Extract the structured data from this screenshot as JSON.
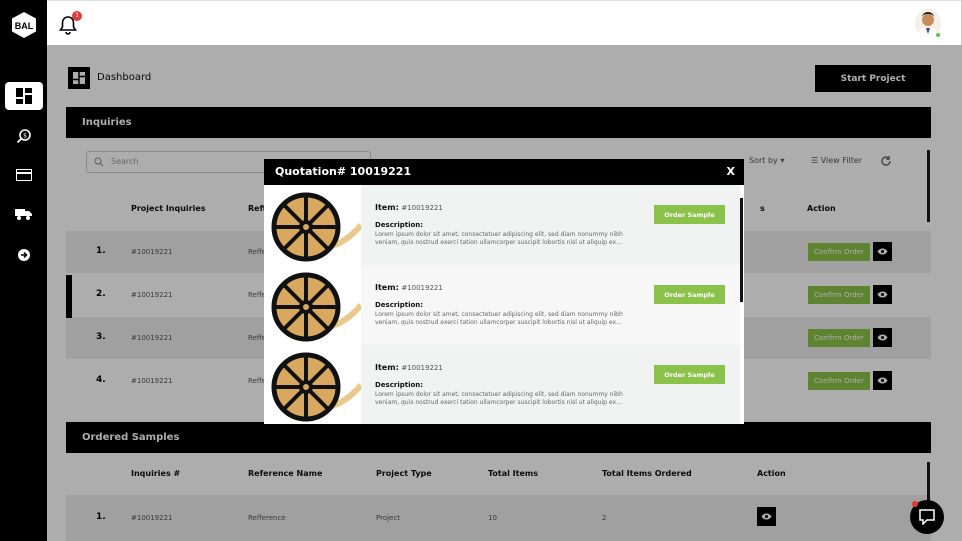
{
  "sidebar": {
    "logo_text": "BAL",
    "items": [
      {
        "icon": "dashboard-icon",
        "active": true
      },
      {
        "icon": "search-dollar-icon",
        "active": false
      },
      {
        "icon": "credit-card-icon",
        "active": false
      },
      {
        "icon": "delivery-truck-icon",
        "active": false
      },
      {
        "icon": "logout-arrow-icon",
        "active": false
      }
    ]
  },
  "topbar": {
    "notification_count": "1",
    "avatar_status": "online"
  },
  "page": {
    "title": "Dashboard",
    "start_project_label": "Start Project"
  },
  "inquiries": {
    "title": "Inquiries",
    "search_placeholder": "Search",
    "sort_label": "Sort by",
    "view_filter_label": "View Filter",
    "columns": [
      "Project Inquiries",
      "Reffe",
      "s",
      "Action"
    ],
    "rows": [
      {
        "num": "1.",
        "id": "#10019221",
        "ref": "Refferer",
        "action": "Confirm Order"
      },
      {
        "num": "2.",
        "id": "#10019221",
        "ref": "Refferer",
        "action": "Confirm Order"
      },
      {
        "num": "3.",
        "id": "#10019221",
        "ref": "Refferer",
        "action": "Confirm Order"
      },
      {
        "num": "4.",
        "id": "#10019221",
        "ref": "Refferer",
        "action": "Confirm Order"
      }
    ]
  },
  "ordered": {
    "title": "Ordered Samples",
    "columns": [
      "Inquiries #",
      "Reference Name",
      "Project Type",
      "Total Items",
      "Total Items Ordered",
      "Action"
    ],
    "rows": [
      {
        "num": "1.",
        "id": "#10019221",
        "ref": "Refference",
        "type": "Project",
        "total": "10",
        "ordered": "2"
      }
    ]
  },
  "modal": {
    "title": "Quotation# 10019221",
    "close": "X",
    "items": [
      {
        "item_label": "Item:",
        "item_value": "#10019221",
        "desc_label": "Description:",
        "desc": "Lorem ipsum dolor sit amet, consectetuer adipiscing elit, sed diam nonummy nibh veniam, quis nostrud exerci tation ullamcorper suscipit lobortis nisl ut aliquip ex...",
        "button": "Order Sample"
      },
      {
        "item_label": "Item:",
        "item_value": "#10019221",
        "desc_label": "Description:",
        "desc": "Lorem ipsum dolor sit amet, consectetuer adipiscing elit, sed diam nonummy nibh veniam, quis nostrud exerci tation ullamcorper suscipit lobortis nisl ut aliquip ex...",
        "button": "Order Sample"
      },
      {
        "item_label": "Item:",
        "item_value": "#10019221",
        "desc_label": "Description:",
        "desc": "Lorem ipsum dolor sit amet, consectetuer adipiscing elit, sed diam nonummy nibh veniam, quis nostrud exerci tation ullamcorper suscipit lobortis nisl ut aliquip ex...",
        "button": "Order Sample"
      }
    ]
  },
  "colors": {
    "accent": "#8bc34a",
    "primary": "#000000",
    "badge": "#e53935"
  }
}
